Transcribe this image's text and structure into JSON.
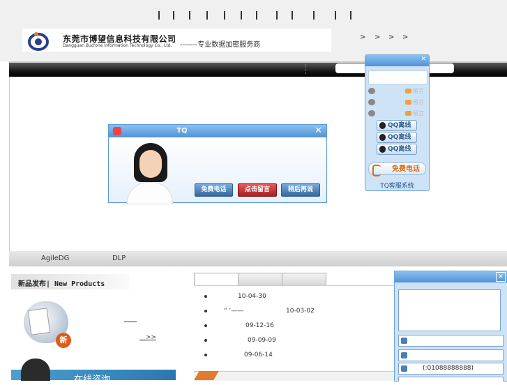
{
  "header": {
    "company_cn": "东莞市博望信息科技有限公司",
    "company_en": "Dangguan Bud'one Information Technology Co., Ltd.",
    "slogan": "-------专业数据加密服务商",
    "top_separators": [
      "|",
      "|",
      "|",
      "|",
      "|",
      "|",
      "|",
      "|",
      "|",
      "|",
      "|",
      "|"
    ],
    "chevrons": [
      ">",
      ">",
      ">",
      ">"
    ]
  },
  "product_tabs": [
    "AgileDG",
    "DLP"
  ],
  "new_products": {
    "title": "新品发布| New Products",
    "badge": "新",
    "more": "__>>"
  },
  "consult": {
    "label": "在线咨询"
  },
  "news": [
    {
      "date": "10-04-30"
    },
    {
      "prefix": "“      ‘——",
      "date": "10-03-02"
    },
    {
      "date": "09-12-16"
    },
    {
      "date": "09-09-09"
    },
    {
      "date": "09-06-14"
    }
  ],
  "tq_popup": {
    "title": "TQ",
    "close": "✕",
    "buttons": [
      "免费电话",
      "点击留言",
      "稍后再说"
    ]
  },
  "qq_float": {
    "close": "✕",
    "rows": [
      "留言",
      "留言",
      "留言"
    ],
    "buttons": [
      "QQ离线",
      "QQ离线",
      "QQ离线"
    ],
    "phone": "免费电话",
    "footer": "TQ客服系统"
  },
  "chat_panel": {
    "close": "✕",
    "phone": "(:01088888888)"
  },
  "colors": {
    "accent_blue": "#4f93d8",
    "panel_blue": "#cfe3f7",
    "call_red": "#a81f1f",
    "new_badge": "#e15a1c"
  }
}
